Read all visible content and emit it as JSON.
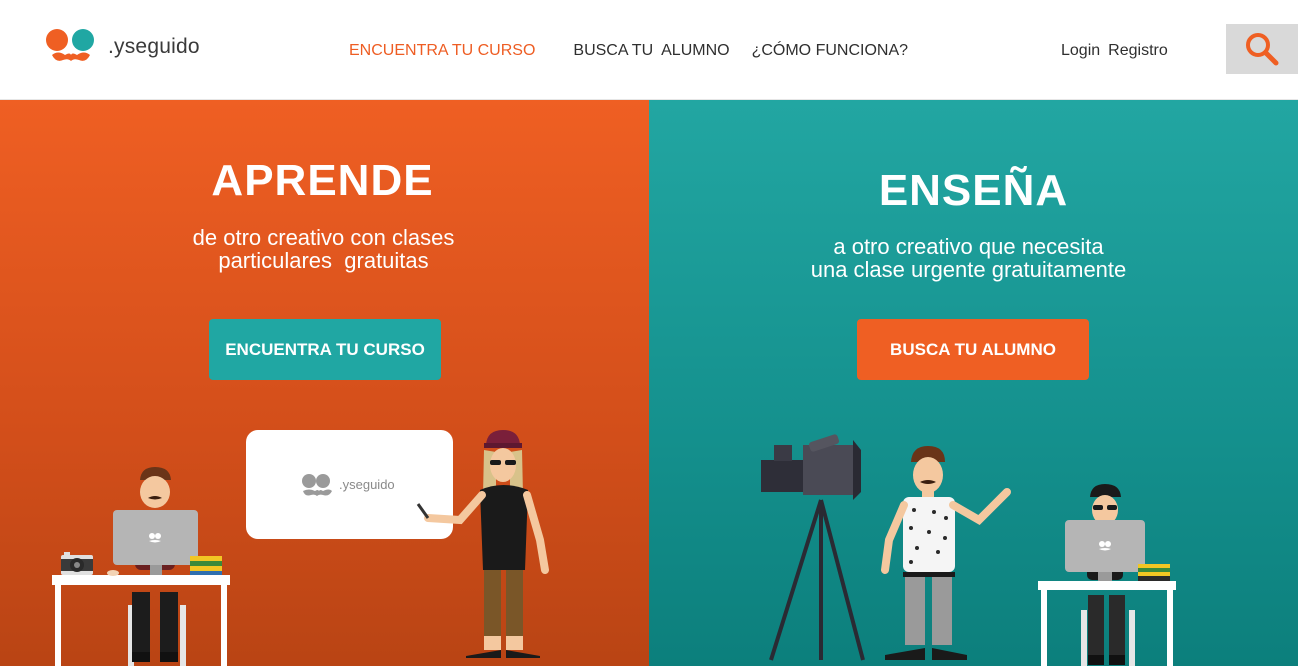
{
  "header": {
    "logo_text": ".yseguido",
    "nav": {
      "find_course": "ENCUENTRA TU CURSO",
      "find_student": "BUSCA TU  ALUMNO",
      "how_it_works": "¿CÓMO FUNCIONA?"
    },
    "login": "Login",
    "register": "Registro"
  },
  "learn": {
    "title": "APRENDE",
    "subtitle_line1": "de otro creativo con clases",
    "subtitle_line2": "particulares  gratuitas",
    "button": "ENCUENTRA TU CURSO",
    "screen_logo": ".yseguido"
  },
  "teach": {
    "title": "ENSEÑA",
    "subtitle_line1": "a otro creativo que necesita",
    "subtitle_line2": "una clase urgente gratuitamente",
    "button": "BUSCA TU ALUMNO"
  },
  "colors": {
    "orange": "#ef5f23",
    "teal": "#20a7a3",
    "search_bg": "#d9d9d9"
  },
  "icons": [
    "logo-icon",
    "search-icon",
    "laptop-icon",
    "camera-icon",
    "video-camera-icon"
  ]
}
